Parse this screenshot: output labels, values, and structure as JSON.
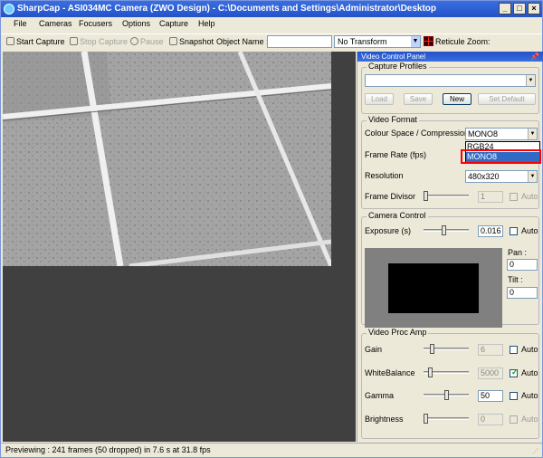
{
  "window": {
    "title": "SharpCap - ASI034MC Camera (ZWO Design) - C:\\Documents and Settings\\Administrator\\Desktop",
    "minimize": "_",
    "maximize": "□",
    "close": "×"
  },
  "menu": [
    "File",
    "Cameras",
    "Focusers",
    "Options",
    "Capture",
    "Help"
  ],
  "toolbar": {
    "start_capture": "Start Capture",
    "stop_capture": "Stop Capture",
    "pause": "Pause",
    "snapshot": "Snapshot",
    "object_name_label": "Object Name :",
    "object_name_value": "",
    "transform_value": "No Transform",
    "reticule": "Reticule",
    "zoom_label": "Zoom:"
  },
  "panel": {
    "title": "Video Control Panel",
    "capture_profiles": {
      "title": "Capture Profiles",
      "value": "",
      "load": "Load",
      "save": "Save",
      "new": "New",
      "set_default": "Set Default"
    },
    "video_format": {
      "title": "Video Format",
      "colour_space_label": "Colour Space / Compression",
      "colour_space_value": "MONO8",
      "dropdown_options": [
        "RGB24",
        "MONO8"
      ],
      "dropdown_selected": "MONO8",
      "frame_rate_label": "Frame Rate (fps)",
      "resolution_label": "Resolution",
      "resolution_value": "480x320",
      "frame_divisor_label": "Frame Divisor",
      "frame_divisor_value": "1",
      "frame_divisor_auto": "Auto",
      "frame_divisor_level": 0.0
    },
    "camera_control": {
      "title": "Camera Control",
      "exposure_label": "Exposure (s)",
      "exposure_value": "0.016",
      "exposure_auto": "Auto",
      "exposure_level": 0.45,
      "pan_label": "Pan :",
      "pan_value": "0",
      "tilt_label": "Tilt :",
      "tilt_value": "0"
    },
    "video_proc_amp": {
      "title": "Video Proc Amp",
      "gain_label": "Gain",
      "gain_value": "6",
      "gain_auto": "Auto",
      "gain_level": 0.15,
      "white_balance_label": "WhiteBalance",
      "white_balance_value": "5000",
      "white_balance_auto": "Auto",
      "white_balance_checked": true,
      "white_balance_level": 0.1,
      "gamma_label": "Gamma",
      "gamma_value": "50",
      "gamma_auto": "Auto",
      "gamma_level": 0.5,
      "brightness_label": "Brightness",
      "brightness_value": "0",
      "brightness_auto": "Auto",
      "brightness_level": 0.0
    }
  },
  "status": {
    "text": "Previewing : 241 frames (50 dropped) in 7.6 s at 31.8 fps"
  }
}
